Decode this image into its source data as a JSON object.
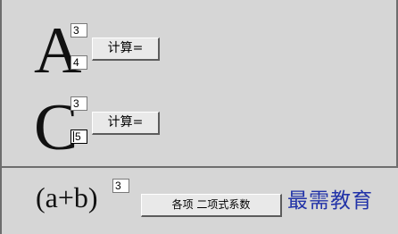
{
  "row_a": {
    "letter": "A",
    "exponent_value": "3",
    "input_value": "4",
    "button_label": "计算="
  },
  "row_c": {
    "letter": "C",
    "exponent_value": "3",
    "input_value": "5",
    "button_label": "计算="
  },
  "binomial": {
    "expression": "(a+b)",
    "exponent_value": "3",
    "button_label": "各项 二项式系数"
  },
  "watermark": {
    "text": "最需教育",
    "color": "#2233a8"
  }
}
